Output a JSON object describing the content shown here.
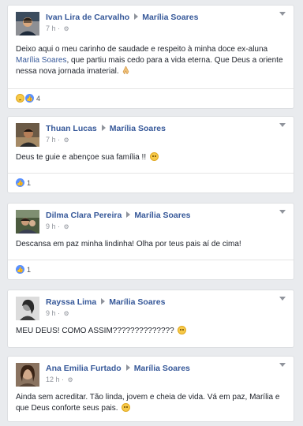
{
  "posts": [
    {
      "author": "Ivan Lira de Carvalho",
      "target": "Marília Soares",
      "time": "7 h",
      "text_before": "Deixo aqui o meu carinho de saudade e respeito à minha doce ex-aluna ",
      "mention": "Marília Soares",
      "text_after": ", que partiu mais cedo para a vida eterna. Que Deus a oriente nessa nova jornada imaterial.",
      "reaction_count": "4"
    },
    {
      "author": "Thuan Lucas",
      "target": "Marília Soares",
      "time": "7 h",
      "text": "Deus te guie e abençoe sua família !!",
      "reaction_count": "1"
    },
    {
      "author": "Dilma Clara Pereira",
      "target": "Marília Soares",
      "time": "9 h",
      "text": "Descansa em paz minha lindinha! Olha por teus pais aí de cima!",
      "reaction_count": "1"
    },
    {
      "author": "Rayssa Lima",
      "target": "Marília Soares",
      "time": "9 h",
      "text": "MEU DEUS! COMO ASSIM??????????????"
    },
    {
      "author": "Ana Emilia Furtado",
      "target": "Marília Soares",
      "time": "12 h",
      "text": "Ainda sem acreditar. Tão linda, jovem e cheia de vida. Vá em paz, Marília e que Deus conforte seus pais."
    }
  ],
  "icons": {
    "arrow": "right-triangle-icon",
    "privacy": "gear-icon",
    "menu": "chevron-down-icon",
    "like": "like-icon",
    "sad": "sad-icon",
    "emoji": "emoji-icon",
    "pray": "praying-hands-icon"
  },
  "colors": {
    "link": "#365899",
    "background": "#e9ebee",
    "like_blue": "#5890ff"
  }
}
